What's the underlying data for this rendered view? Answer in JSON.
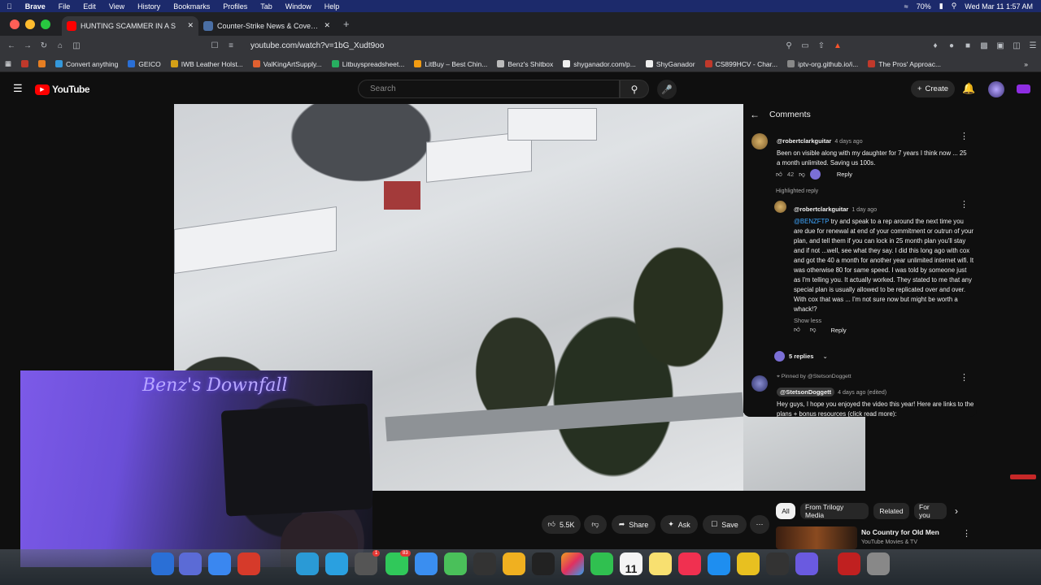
{
  "menubar": {
    "app": "Brave",
    "items": [
      "File",
      "Edit",
      "View",
      "History",
      "Bookmarks",
      "Profiles",
      "Tab",
      "Window",
      "Help"
    ],
    "battery": "70%",
    "datetime": "Wed Mar 11  1:57 AM"
  },
  "tabs": [
    {
      "title": "HUNTING SCAMMER IN A S",
      "active": true
    },
    {
      "title": "Counter-Strike News & Coverage",
      "active": false
    }
  ],
  "address": {
    "url": "youtube.com/watch?v=1bG_Xudt9oo"
  },
  "bookmarks": [
    "Convert anything",
    "GEICO",
    "IWB Leather Holst...",
    "ValKingArtSupply...",
    "Litbuyspreadsheet...",
    "LitBuy – Best Chin...",
    "Benz's Shitbox",
    "shyganador.com/p...",
    "ShyGanador",
    "CS899HCV - Char...",
    "iptv-org.github.io/i...",
    "The Pros' Approac..."
  ],
  "youtube": {
    "logo_text": "YouTube",
    "search_placeholder": "Search",
    "create_label": "Create"
  },
  "overlay": {
    "name": "Benz's Downfall"
  },
  "comments_panel": {
    "title": "Comments",
    "comment1": {
      "author": "@robertclarkguitar",
      "time": "4 days ago",
      "text": "Been on visible along with my daughter for 7 years I think now ... 25 a month unlimited. Saving us 100s.",
      "likes": "42",
      "reply_label": "Reply"
    },
    "highlighted_label": "Highlighted reply",
    "reply1": {
      "author": "@robertclarkguitar",
      "time": "1 day ago",
      "mention": "@BENZFTP",
      "text": "try and speak to a rep around the next time you are due for renewal at end of your commitment or outrun of your plan, and tell them if you can lock in 25 month plan you'll stay and if not ...well, see what they say. I did this long ago with cox and got the 40 a month for another year unlimited internet wifi. It was otherwise 80 for same speed. I was told by someone just as I'm telling you. It actually worked. They stated to me that any special plan is usually allowed to be replicated over and over. With cox that was ... I'm not sure now but might be worth a whack!?",
      "show_less": "Show less",
      "reply_label": "Reply"
    },
    "replies_count": "5 replies",
    "pinned": {
      "pinned_by": "Pinned by @StetsonDoggett",
      "author": "@StetsonDoggett",
      "time": "4 days ago (edited)",
      "text": "Hey guys, I hope you enjoyed the video this year! Here are links to the plans + bonus resources (click read more):"
    }
  },
  "actions": {
    "likes": "5.5K",
    "share": "Share",
    "ask": "Ask",
    "save": "Save"
  },
  "chips": [
    "All",
    "From Trilogy Media",
    "Related",
    "For you"
  ],
  "related": {
    "title": "No Country for Old Men",
    "channel": "YouTube Movies & TV"
  },
  "dock": {
    "badge_messages": "83",
    "badge_dot": "1",
    "calendar_day": "11"
  },
  "colors": {
    "accent_red": "#ff0000",
    "link_blue": "#3ea6ff",
    "menubar": "#1c2a6b"
  }
}
